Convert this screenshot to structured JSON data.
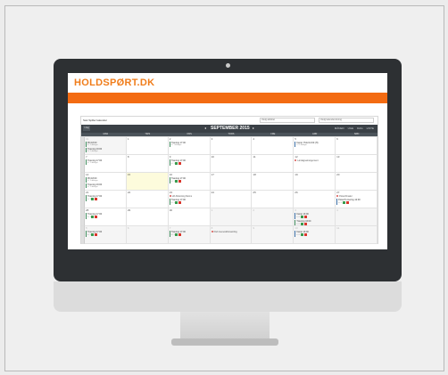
{
  "brand": {
    "logo_text": "HOLDSPØRT.DK",
    "accent": "#f36b12"
  },
  "app": {
    "team_name": "Sæt Spiller kalender",
    "select_1": "Vælg aktivitet",
    "select_2": "Vælg kalendervisning"
  },
  "calendar": {
    "today_label": "I dag",
    "title": "SEPTEMBER 2015",
    "views": [
      "MÅNED",
      "UGE",
      "DAG",
      "LISTE"
    ],
    "weekdays": [
      "MAN",
      "TIRS",
      "ONS",
      "TORS",
      "FRE",
      "LØR",
      "SØN"
    ],
    "weeks": [
      [
        {
          "n": "31",
          "other": true,
          "events": [
            {
              "t": "Pilt 18:00",
              "s": "0 / 1 deltager"
            },
            {
              "t": "Træning 19:00",
              "s": "0 / 1 deltager"
            }
          ]
        },
        {
          "n": "1",
          "events": []
        },
        {
          "n": "2",
          "events": [
            {
              "t": "Træning 17:00",
              "s": "0 / 1 deltager"
            }
          ]
        },
        {
          "n": "3",
          "events": []
        },
        {
          "n": "4",
          "events": []
        },
        {
          "n": "5",
          "events": [
            {
              "t": "Kamp: Hold 14:00 (H)",
              "s": "0 / 1 deltager",
              "blue": true
            }
          ]
        },
        {
          "n": "6",
          "events": []
        }
      ],
      [
        {
          "n": "7",
          "events": [
            {
              "t": "Træning 17:00",
              "s": "0 / 1 deltager"
            }
          ]
        },
        {
          "n": "8",
          "events": []
        },
        {
          "n": "9",
          "events": [
            {
              "t": "Træning 17:00",
              "s": "0 / 1",
              "badges": true
            }
          ]
        },
        {
          "n": "10",
          "events": []
        },
        {
          "n": "11",
          "events": []
        },
        {
          "n": "12",
          "events": [],
          "note": "Lørdagsarrangement"
        },
        {
          "n": "13",
          "events": []
        }
      ],
      [
        {
          "n": "14",
          "events": [
            {
              "t": "Pilt 18:00",
              "s": "0 / 1 deltager"
            },
            {
              "t": "Træning 19:00",
              "s": "0 / 1 deltager"
            }
          ]
        },
        {
          "n": "15",
          "today": true,
          "events": []
        },
        {
          "n": "16",
          "events": [
            {
              "t": "Træning 17:00",
              "s": "0 / 1",
              "badges": true
            }
          ]
        },
        {
          "n": "17",
          "events": []
        },
        {
          "n": "18",
          "events": []
        },
        {
          "n": "19",
          "events": []
        },
        {
          "n": "20",
          "events": []
        }
      ],
      [
        {
          "n": "21",
          "events": [
            {
              "t": "Træning 17:00",
              "s": "0 / 1",
              "badges": true
            }
          ]
        },
        {
          "n": "22",
          "events": []
        },
        {
          "n": "23",
          "events": [
            {
              "t": "Træning 17:00",
              "s": "0 / 1",
              "badges": true
            }
          ],
          "note": "Lift Afslutning Moms"
        },
        {
          "n": "24",
          "events": []
        },
        {
          "n": "25",
          "events": []
        },
        {
          "n": "26",
          "events": []
        },
        {
          "n": "27",
          "events": [
            {
              "t": "Pokal Turnering 12:00",
              "s": "0 / 1",
              "badges": true,
              "blue": true
            }
          ],
          "note": "Pokal Finaler"
        }
      ],
      [
        {
          "n": "28",
          "events": [
            {
              "t": "Træning 17:00",
              "s": "0 / 1",
              "badges": true
            }
          ]
        },
        {
          "n": "29",
          "events": []
        },
        {
          "n": "30",
          "events": []
        },
        {
          "n": "1",
          "other": true,
          "events": []
        },
        {
          "n": "2",
          "other": true,
          "events": []
        },
        {
          "n": "3",
          "other": true,
          "events": [
            {
              "t": "Kamp 13:00",
              "s": "0 / 1",
              "badges": true,
              "blue": true
            },
            {
              "t": "Træning 16:00",
              "s": "0 / 1",
              "badges": true
            }
          ]
        },
        {
          "n": "4",
          "other": true,
          "events": []
        }
      ],
      [
        {
          "n": "5",
          "other": true,
          "events": [
            {
              "t": "Træning 17:00",
              "s": "0 / 1",
              "badges": true
            }
          ]
        },
        {
          "n": "6",
          "other": true,
          "events": []
        },
        {
          "n": "7",
          "other": true,
          "events": [
            {
              "t": "Træning 17:00",
              "s": "0 / 1",
              "badges": true
            }
          ]
        },
        {
          "n": "8",
          "other": true,
          "events": [],
          "note": "Klub Generalforsamling"
        },
        {
          "n": "9",
          "other": true,
          "events": []
        },
        {
          "n": "10",
          "other": true,
          "events": [
            {
              "t": "Kamp 13:00",
              "s": "0 / 1",
              "badges": true,
              "blue": true
            }
          ]
        },
        {
          "n": "11",
          "other": true,
          "events": []
        }
      ]
    ]
  }
}
